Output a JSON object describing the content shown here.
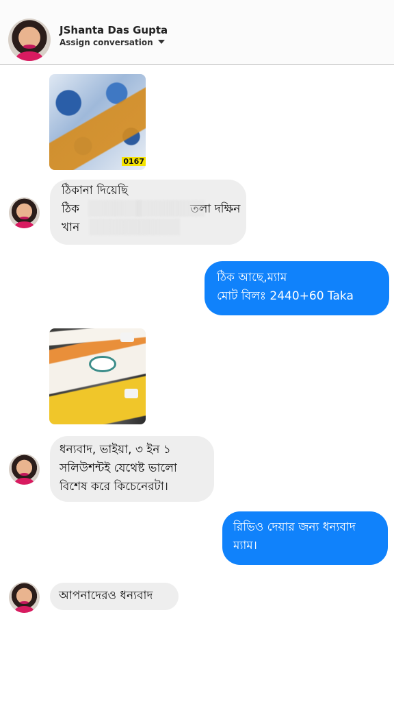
{
  "header": {
    "contact_name": "JShanta Das Gupta",
    "assign_label": "Assign conversation"
  },
  "messages": [
    {
      "type": "image",
      "direction": "incoming",
      "overlay_text": "0167"
    },
    {
      "type": "text",
      "direction": "incoming",
      "lines": [
        "ঠিকানা দিয়েছি",
        "ঠিক                              তলা দক্ষিন",
        "খান"
      ]
    },
    {
      "type": "text",
      "direction": "outgoing",
      "lines": [
        "ঠিক আছে,ম্যাম",
        "মোট বিলঃ 2440+60 Taka"
      ]
    },
    {
      "type": "image",
      "direction": "incoming"
    },
    {
      "type": "text",
      "direction": "incoming",
      "lines": [
        "ধন্যবাদ, ভাইয়া, ৩ ইন ১",
        "সলিউশন্টই যেথেষ্ট ভালো",
        "বিশেষ করে কিচেনেরটা।"
      ]
    },
    {
      "type": "text",
      "direction": "outgoing",
      "lines": [
        "রিভিও দেয়ার জন্য ধন্যবাদ",
        "ম্যাম।"
      ]
    },
    {
      "type": "text",
      "direction": "incoming",
      "lines": [
        "আপনাদেরও ধন্যবাদ"
      ]
    }
  ],
  "colors": {
    "outgoing_bubble": "#1082fb",
    "incoming_bubble": "#eeeeee",
    "header_bg": "#fbfbfb"
  },
  "icons": {
    "assign_dropdown": "caret-down-icon",
    "contact_avatar": "avatar"
  }
}
